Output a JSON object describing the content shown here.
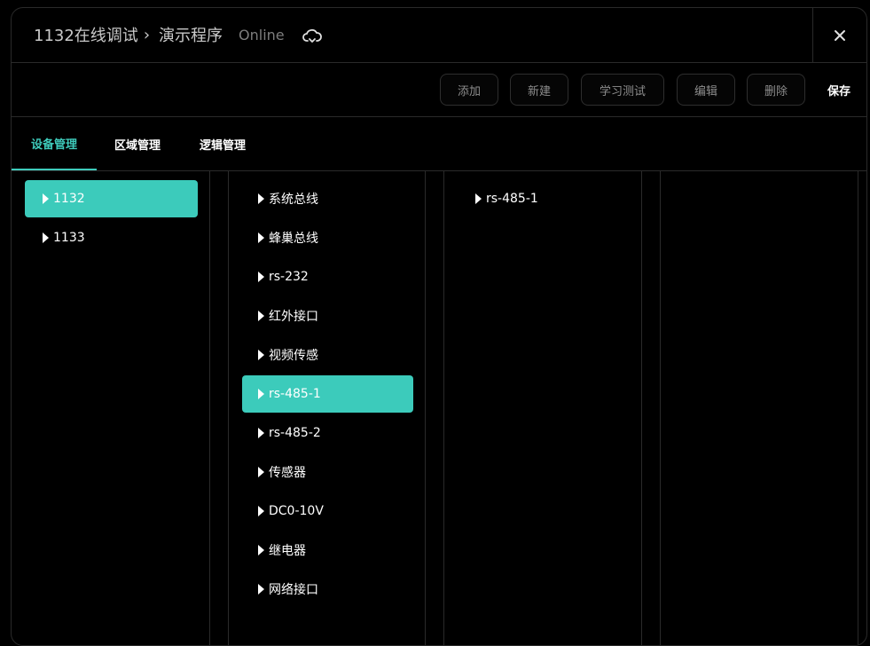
{
  "header": {
    "breadcrumb_root": "1132在线调试",
    "breadcrumb_current": "演示程序",
    "status": "Online"
  },
  "toolbar": {
    "add_label": "添加",
    "new_label": "新建",
    "learn_test_label": "学习测试",
    "edit_label": "编辑",
    "delete_label": "删除",
    "save_label": "保存"
  },
  "tabs": [
    {
      "label": "设备管理",
      "active": true
    },
    {
      "label": "区域管理",
      "active": false
    },
    {
      "label": "逻辑管理",
      "active": false
    }
  ],
  "devices": [
    {
      "label": "1132",
      "selected": true
    },
    {
      "label": "1133",
      "selected": false
    }
  ],
  "buses": [
    {
      "label": "系统总线",
      "selected": false
    },
    {
      "label": "蜂巢总线",
      "selected": false
    },
    {
      "label": "rs-232",
      "selected": false
    },
    {
      "label": "红外接口",
      "selected": false
    },
    {
      "label": "视频传感",
      "selected": false
    },
    {
      "label": "rs-485-1",
      "selected": true
    },
    {
      "label": "rs-485-2",
      "selected": false
    },
    {
      "label": "传感器",
      "selected": false
    },
    {
      "label": "DC0-10V",
      "selected": false
    },
    {
      "label": "继电器",
      "selected": false
    },
    {
      "label": "网络接口",
      "selected": false
    }
  ],
  "sub_items": [
    {
      "label": "rs-485-1",
      "selected": false
    }
  ],
  "colors": {
    "accent": "#3ccbbb",
    "background": "#000000",
    "border": "#2a2a2a"
  }
}
